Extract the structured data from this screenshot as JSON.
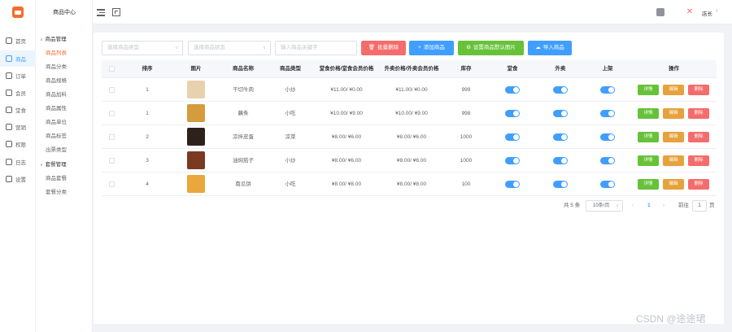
{
  "rail": {
    "items": [
      {
        "label": "首页",
        "icon": "home-icon",
        "active": false
      },
      {
        "label": "商品",
        "icon": "goods-icon",
        "active": true
      },
      {
        "label": "订单",
        "icon": "order-icon",
        "active": false
      },
      {
        "label": "会员",
        "icon": "member-icon",
        "active": false
      },
      {
        "label": "堂食",
        "icon": "dine-in-icon",
        "active": false
      },
      {
        "label": "营销",
        "icon": "marketing-icon",
        "active": false
      },
      {
        "label": "权限",
        "icon": "lock-icon",
        "active": false
      },
      {
        "label": "日志",
        "icon": "log-icon",
        "active": false
      },
      {
        "label": "设置",
        "icon": "gear-icon",
        "active": false
      }
    ]
  },
  "submenu": {
    "title": "商品中心",
    "groups": [
      {
        "label": "商品管理",
        "items": [
          "商品列表",
          "商品分类",
          "商品规格",
          "商品加料",
          "商品属性",
          "商品单位",
          "商品标签",
          "出票类型"
        ]
      },
      {
        "label": "套餐管理",
        "items": [
          "商品套餐",
          "套餐分类"
        ]
      }
    ],
    "active_item": "商品列表"
  },
  "topbar": {
    "user_name": "店长",
    "user_chevron": "‹"
  },
  "filters": [
    {
      "placeholder": "选择商品类型",
      "has_arrow": true
    },
    {
      "placeholder": "选择商品状态",
      "has_arrow": true
    },
    {
      "placeholder": "输入商品关键字",
      "has_arrow": false
    }
  ],
  "buttons": [
    {
      "label": "批量删除",
      "icon": "🗑",
      "color": "#f56c6c"
    },
    {
      "label": "添加商品",
      "icon": "+",
      "color": "#409eff"
    },
    {
      "label": "设置商品默认图片",
      "icon": "⚙",
      "color": "#67c23a"
    },
    {
      "label": "导入商品",
      "icon": "☁",
      "color": "#409eff"
    }
  ],
  "table": {
    "headers": [
      "排序",
      "图片",
      "商品名称",
      "商品类型",
      "堂食价格/堂食会员价格",
      "外卖价格/外卖会员价格",
      "库存",
      "堂食",
      "外卖",
      "上架",
      "操作"
    ],
    "rows": [
      {
        "sort": "1",
        "name": "干切牛肉",
        "type": "小炒",
        "dine_price": "¥11.00/ ¥0.00",
        "takeout_price": "¥11.00/ ¥0.00",
        "stock": "999",
        "thumb": "#e8d2ae"
      },
      {
        "sort": "1",
        "name": "藕条",
        "type": "小吃",
        "dine_price": "¥10.00/ ¥9.00",
        "takeout_price": "¥10.00/ ¥9.00",
        "stock": "998",
        "thumb": "#d59b3f"
      },
      {
        "sort": "2",
        "name": "凉拌皮蛋",
        "type": "凉菜",
        "dine_price": "¥8.00/ ¥6.00",
        "takeout_price": "¥8.00/ ¥6.00",
        "stock": "1000",
        "thumb": "#2c221c"
      },
      {
        "sort": "3",
        "name": "油焖茄子",
        "type": "小炒",
        "dine_price": "¥8.00/ ¥6.00",
        "takeout_price": "¥8.00/ ¥6.00",
        "stock": "1000",
        "thumb": "#7a3a22"
      },
      {
        "sort": "4",
        "name": "南瓜饼",
        "type": "小吃",
        "dine_price": "¥8.00/ ¥8.00",
        "takeout_price": "¥8.00/ ¥8.00",
        "stock": "100",
        "thumb": "#e9a73c"
      }
    ],
    "actions": [
      {
        "label": "详情",
        "color": "#67c23a"
      },
      {
        "label": "编辑",
        "color": "#e6a23c"
      },
      {
        "label": "删除",
        "color": "#f56c6c"
      }
    ]
  },
  "pagination": {
    "total": "共 5 条",
    "page_size": "10条/页",
    "prev": "‹",
    "current": "1",
    "next": "›",
    "goto_label": "前往",
    "goto_value": "1",
    "page_unit": "页"
  },
  "watermark": "CSDN @途途珺",
  "colors": {
    "primary": "#409eff",
    "accent": "#f56c2d",
    "success": "#67c23a",
    "warning": "#e6a23c",
    "danger": "#f56c6c"
  }
}
